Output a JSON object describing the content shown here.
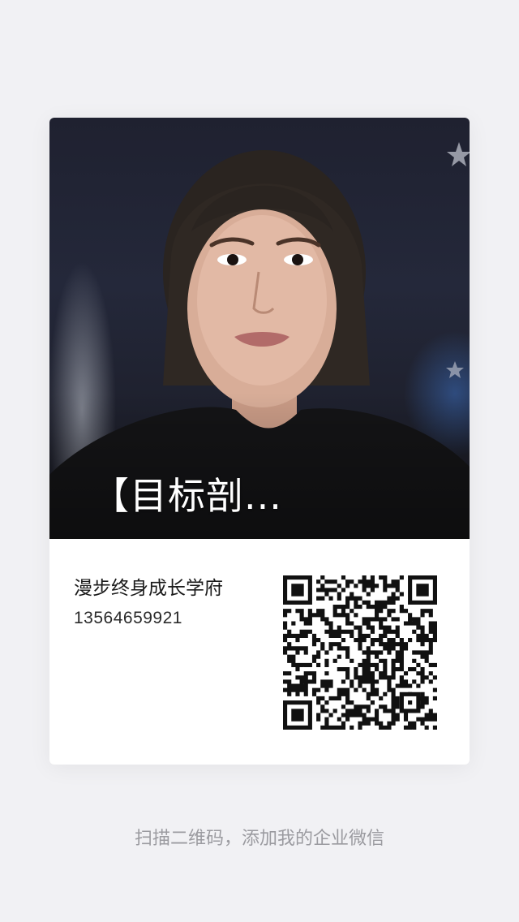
{
  "card": {
    "photo_title": "【目标剖...",
    "name": "漫步终身成长学府",
    "phone": "13564659921",
    "qr_icon": "qr-code-icon"
  },
  "footer": {
    "hint": "扫描二维码，添加我的企业微信"
  },
  "colors": {
    "page_background": "#f1f1f4",
    "card_background": "#ffffff",
    "hint_text": "#9b9ba0"
  }
}
